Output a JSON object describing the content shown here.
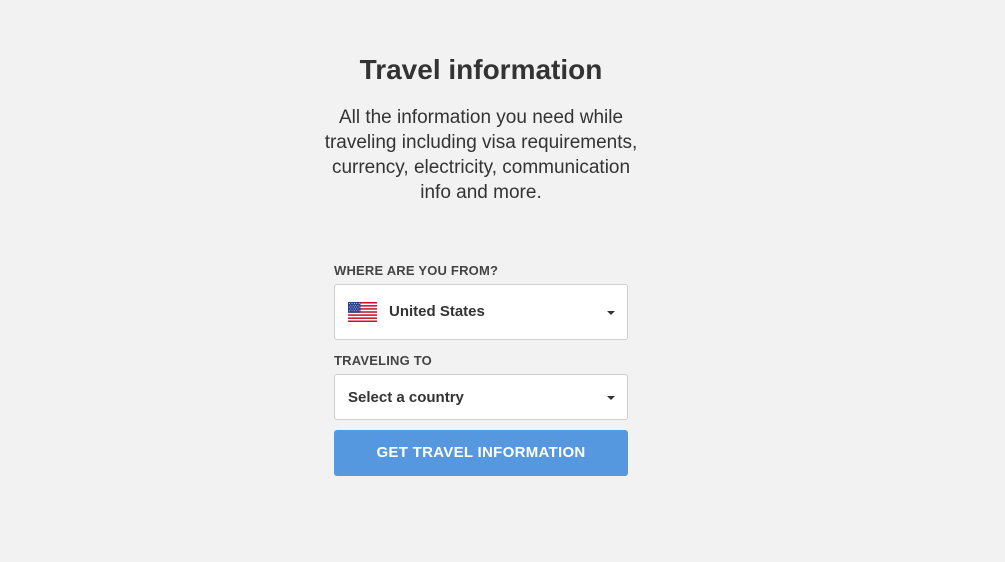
{
  "header": {
    "title": "Travel information",
    "description": "All the information you need while traveling including visa requirements, currency, electricity, communication info and more."
  },
  "form": {
    "from": {
      "label": "WHERE ARE YOU FROM?",
      "value": "United States",
      "flag_icon": "us-flag-icon"
    },
    "to": {
      "label": "TRAVELING TO",
      "placeholder": "Select a country"
    },
    "submit_label": "GET TRAVEL INFORMATION"
  },
  "colors": {
    "background": "#f2f2f2",
    "button": "#5598e0",
    "text": "#333333"
  }
}
